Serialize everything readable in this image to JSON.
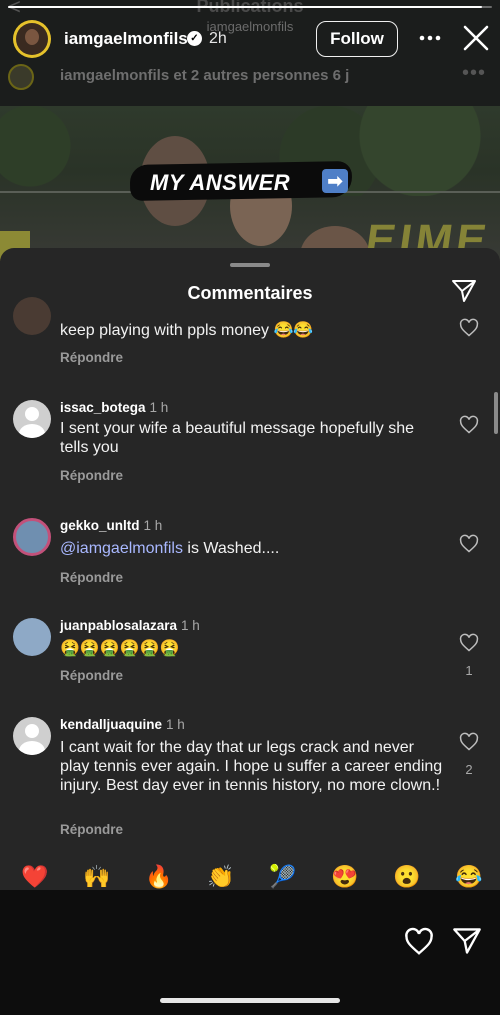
{
  "background": {
    "ghost_title": "Publications",
    "ghost_subtitle": "iamgaelmonfils",
    "ghost_back": "<",
    "ghost_activity": "iamgaelmonfils et 2 autres personnes  6 j",
    "ghost_more": "•••",
    "banner_text": "EIME",
    "sticker_text": "MY ANSWER",
    "sticker_arrow": "➡"
  },
  "story": {
    "progress": 0.98
  },
  "header": {
    "username": "iamgaelmonfils",
    "verified_icon": "✓",
    "time": "2h",
    "follow_label": "Follow"
  },
  "sheet": {
    "title": "Commentaires"
  },
  "comments": [
    {
      "username": "",
      "time": "",
      "text": "keep playing with ppls money",
      "emojis": "😂😂",
      "reply": "Répondre",
      "likes": ""
    },
    {
      "username": "issac_botega",
      "time": "1 h",
      "text": "I sent your wife a beautiful message hopefully she tells you",
      "reply": "Répondre",
      "likes": ""
    },
    {
      "username": "gekko_unltd",
      "time": "1 h",
      "mention": "@iamgaelmonfils",
      "text": " is Washed....",
      "reply": "Répondre",
      "likes": ""
    },
    {
      "username": "juanpablosalazara",
      "time": "1 h",
      "text": "",
      "emojis": "🤮🤮🤮🤮🤮🤮",
      "reply": "Répondre",
      "likes": "1"
    },
    {
      "username": "kendalljuaquine",
      "time": "1 h",
      "text": "I cant wait for the day that ur legs crack and never play tennis ever again. I hope u suffer a career ending injury. Best day ever in tennis history, no more clown.!",
      "reply": "Répondre",
      "likes": "2"
    }
  ],
  "emoji_bar": [
    "❤️",
    "🙌",
    "🔥",
    "👏",
    "🎾",
    "😍",
    "😮",
    "😂"
  ],
  "colors": {
    "sheet_bg": "#262626",
    "mention": "#a9b8ff",
    "avatar_ring": "#e6c22b"
  }
}
